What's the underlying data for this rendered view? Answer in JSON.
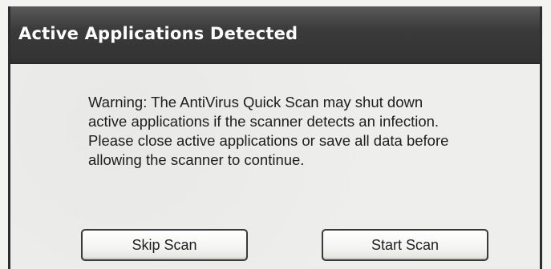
{
  "dialog": {
    "title": "Active Applications Detected",
    "message_lines": [
      "Warning: The AntiVirus Quick Scan may shut down",
      "active applications if the scanner detects an infection.",
      "Please close active applications or save all data before",
      "allowing the scanner to continue."
    ],
    "buttons": {
      "skip_label": "Skip Scan",
      "start_label": "Start Scan"
    }
  }
}
